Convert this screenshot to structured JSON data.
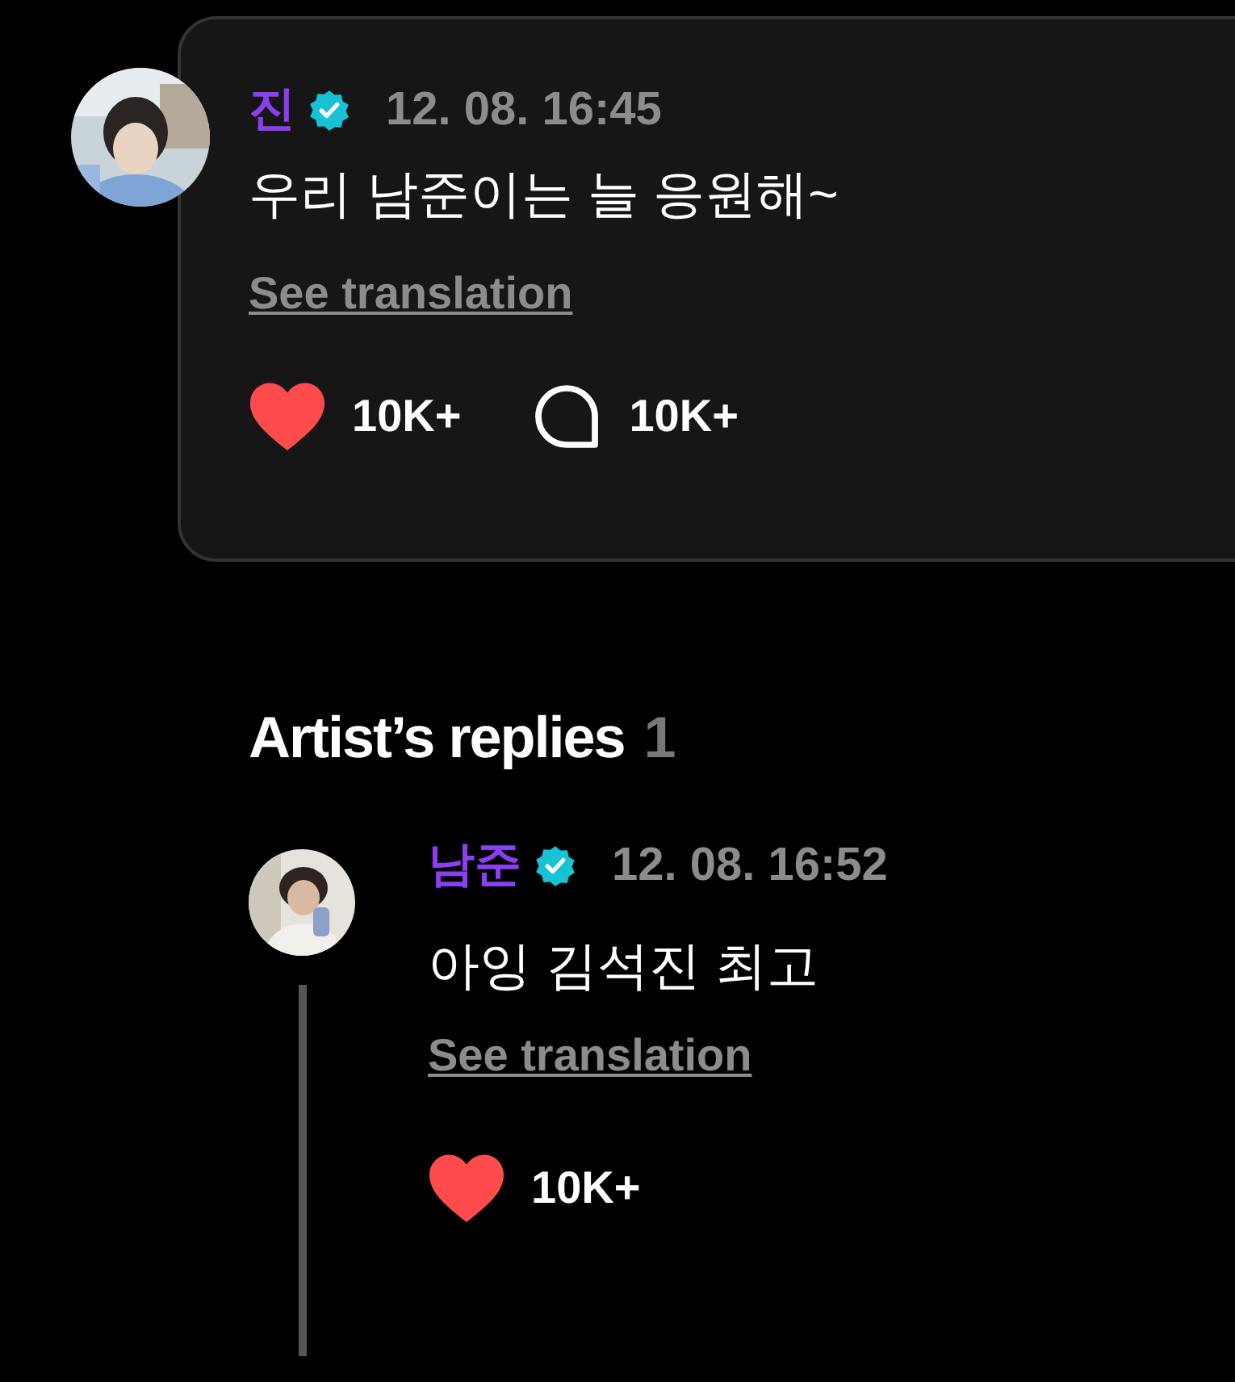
{
  "post": {
    "author": "진",
    "verified": true,
    "time": "12. 08. 16:45",
    "text": "우리 남준이는 늘 응원해~",
    "translate": "See translation",
    "likes": "10K+",
    "comments": "10K+"
  },
  "replies_heading": {
    "title": "Artist’s replies",
    "count": "1"
  },
  "replies": [
    {
      "author": "남준",
      "verified": true,
      "time": "12. 08. 16:52",
      "text": "아잉 김석진 최고",
      "translate": "See translation",
      "likes": "10K+"
    }
  ]
}
